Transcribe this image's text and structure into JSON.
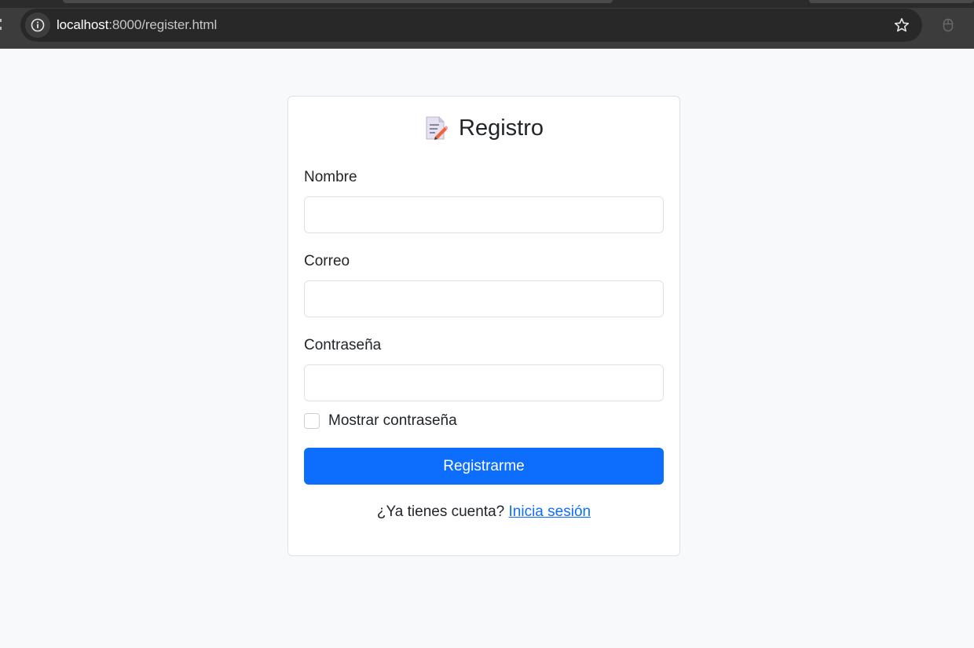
{
  "browser": {
    "url_host": "localhost",
    "url_rest": ":8000/register.html"
  },
  "form": {
    "icon": "memo-icon",
    "title": "Registro",
    "fields": [
      {
        "label": "Nombre",
        "value": ""
      },
      {
        "label": "Correo",
        "value": ""
      },
      {
        "label": "Contraseña",
        "value": ""
      }
    ],
    "show_password_label": "Mostrar contraseña",
    "show_password_checked": false,
    "submit_label": "Registrarme",
    "footer_text": "¿Ya tienes cuenta?",
    "login_link": "Inicia sesión"
  },
  "colors": {
    "primary": "#0d6efd",
    "page_bg": "#f8f9fa",
    "border": "#dee2e6"
  }
}
